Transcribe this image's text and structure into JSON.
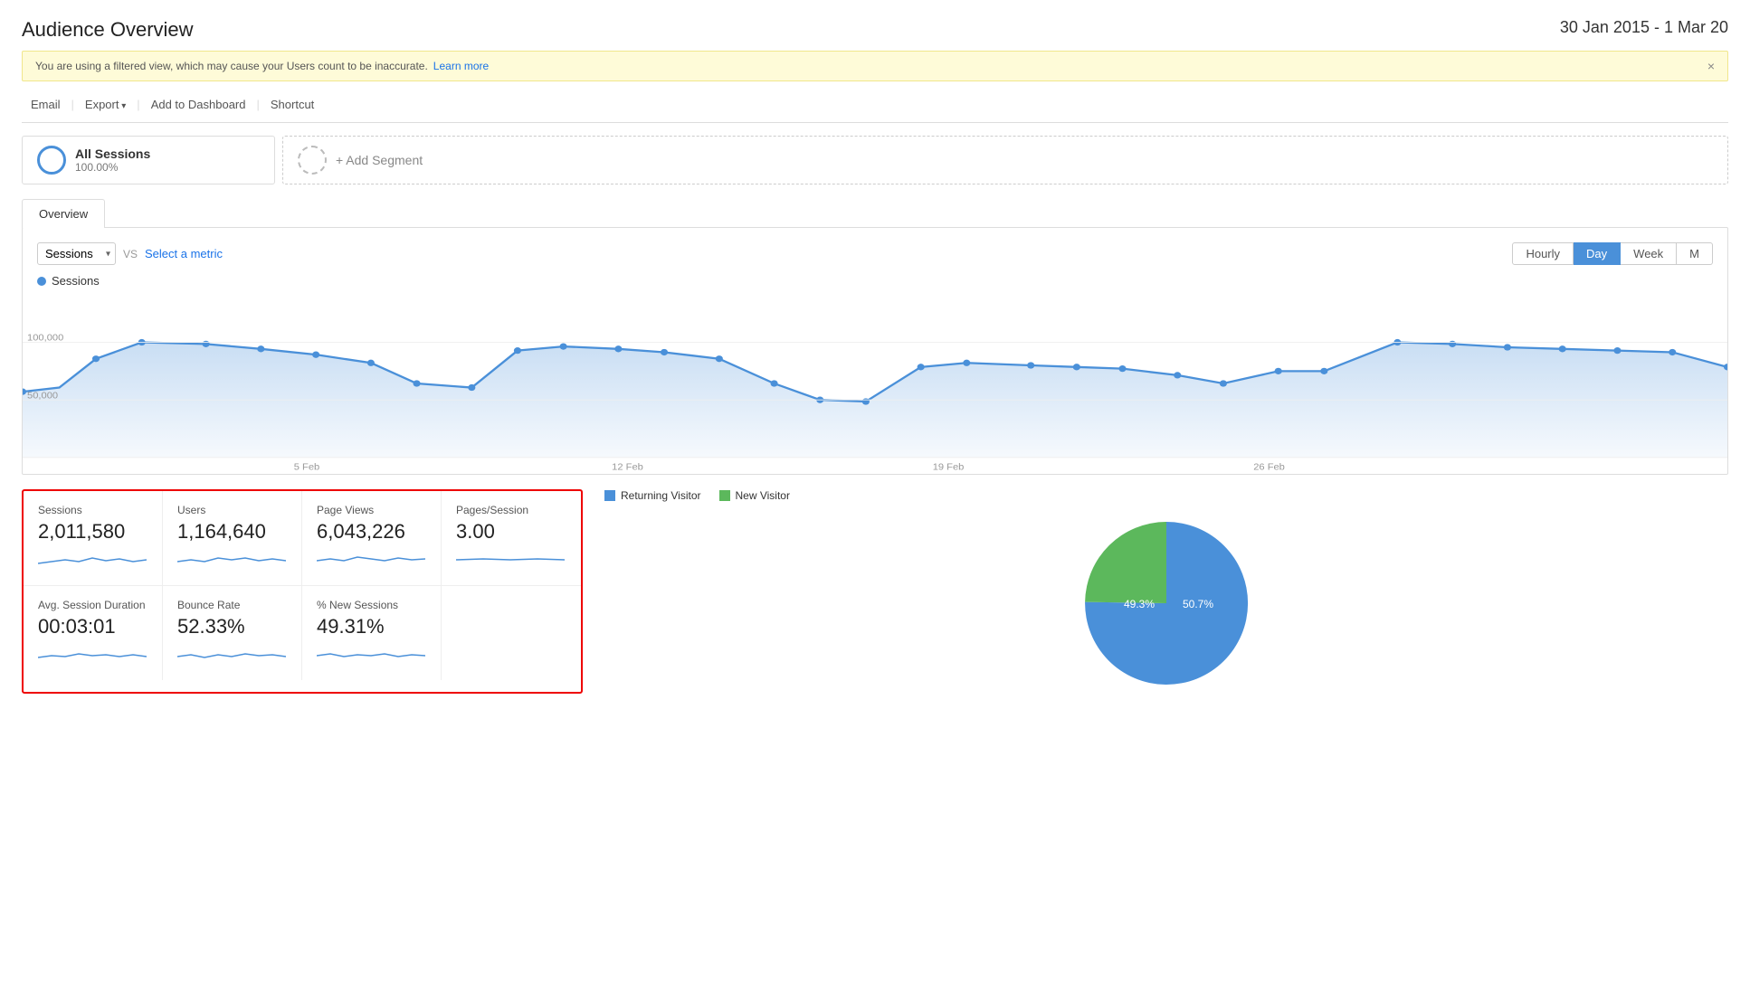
{
  "header": {
    "title": "Audience Overview",
    "date_range": "30 Jan 2015 - 1 Mar 20"
  },
  "alert": {
    "message": "You are using a filtered view, which may cause your Users count to be inaccurate.",
    "link_text": "Learn more",
    "close": "×"
  },
  "toolbar": {
    "email": "Email",
    "export": "Export",
    "add_to_dashboard": "Add to Dashboard",
    "shortcut": "Shortcut"
  },
  "segments": {
    "all_sessions_label": "All Sessions",
    "all_sessions_pct": "100.00%",
    "add_segment": "+ Add Segment"
  },
  "overview_tab": "Overview",
  "chart": {
    "metric_label": "Sessions",
    "vs_label": "VS",
    "select_metric": "Select a metric",
    "legend_label": "Sessions",
    "y_labels": [
      "100,000",
      "50,000"
    ],
    "x_labels": [
      "5 Feb",
      "12 Feb",
      "19 Feb",
      "26 Feb"
    ],
    "time_buttons": [
      "Hourly",
      "Day",
      "Week",
      "M"
    ],
    "active_time_button": "Day"
  },
  "metrics": [
    {
      "label": "Sessions",
      "value": "2,011,580"
    },
    {
      "label": "Users",
      "value": "1,164,640"
    },
    {
      "label": "Page Views",
      "value": "6,043,226"
    },
    {
      "label": "Pages/Session",
      "value": "3.00"
    },
    {
      "label": "Avg. Session Duration",
      "value": "00:03:01"
    },
    {
      "label": "Bounce Rate",
      "value": "52.33%"
    },
    {
      "label": "% New Sessions",
      "value": "49.31%"
    },
    {
      "label": "",
      "value": ""
    }
  ],
  "pie": {
    "returning_visitor_label": "Returning Visitor",
    "new_visitor_label": "New Visitor",
    "returning_pct": "50.7%",
    "new_pct": "49.3%",
    "returning_color": "#4a90d9",
    "new_color": "#5cb85c",
    "returning_value": 50.7,
    "new_value": 49.3
  }
}
